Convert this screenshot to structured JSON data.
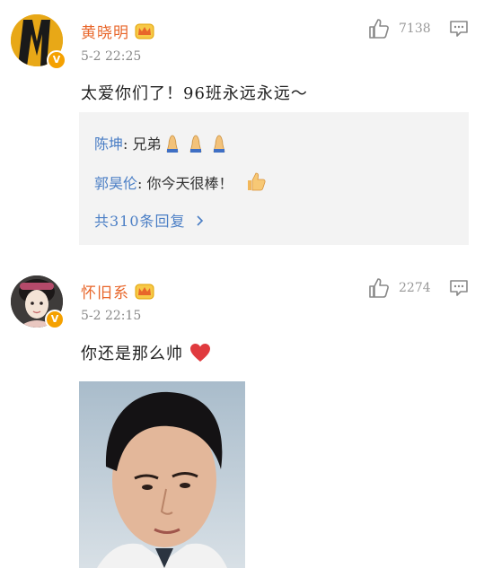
{
  "comments": [
    {
      "username": "黄晓明",
      "timestamp": "5-2 22:25",
      "text": "太爱你们了！96班永远永远～",
      "likes": "7138",
      "replies": [
        {
          "user": "陈坤",
          "text": ": 兄弟"
        },
        {
          "user": "郭昊伦",
          "text": ": 你今天很棒！"
        }
      ],
      "more_replies": "共310条回复",
      "badge": "V"
    },
    {
      "username": "怀旧系",
      "timestamp": "5-2 22:15",
      "text": "你还是那么帅",
      "likes": "2274",
      "badge": "V"
    }
  ],
  "colors": {
    "username": "#e8662a",
    "reply_user": "#4a7ec5",
    "meta": "#888888",
    "reply_bg": "#f3f3f3",
    "vip_badge": "#f5a100"
  },
  "icons": [
    "crown-icon",
    "thumbs-up-icon",
    "reply-icon",
    "verified-badge-icon",
    "pray-emoji-icon",
    "thumbs-up-emoji-icon",
    "heart-emoji-icon",
    "chevron-right-icon"
  ]
}
